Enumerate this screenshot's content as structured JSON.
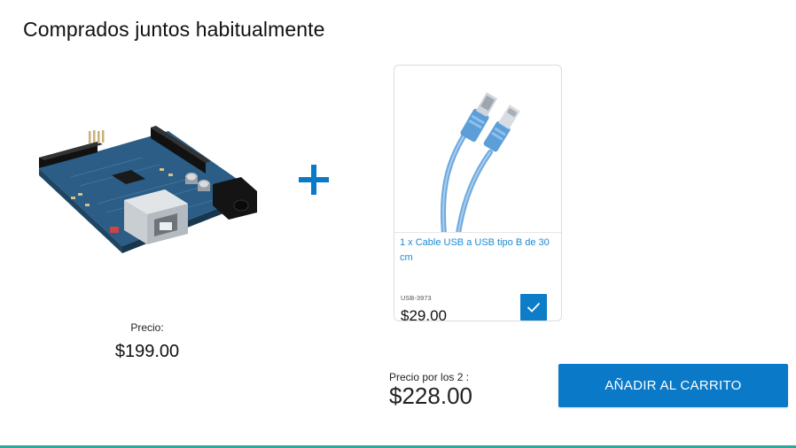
{
  "section": {
    "title": "Comprados juntos habitualmente"
  },
  "main_product": {
    "price_label": "Precio:",
    "price": "$199.00",
    "image_icon": "arduino-board-image"
  },
  "plus_icon": "plus-icon",
  "bundle_item": {
    "name": "1 x Cable USB a USB tipo B de 30 cm",
    "sku": "USB-3973",
    "price": "$29.00",
    "selected": true,
    "image_icon": "usb-cable-image"
  },
  "summary": {
    "total_label": "Precio por los 2 :",
    "total_value": "$228.00",
    "add_to_cart_label": "AÑADIR AL CARRITO"
  },
  "colors": {
    "accent": "#0a79c8",
    "link": "#1a8ad4",
    "bottom_bar": "#2aa99a"
  }
}
